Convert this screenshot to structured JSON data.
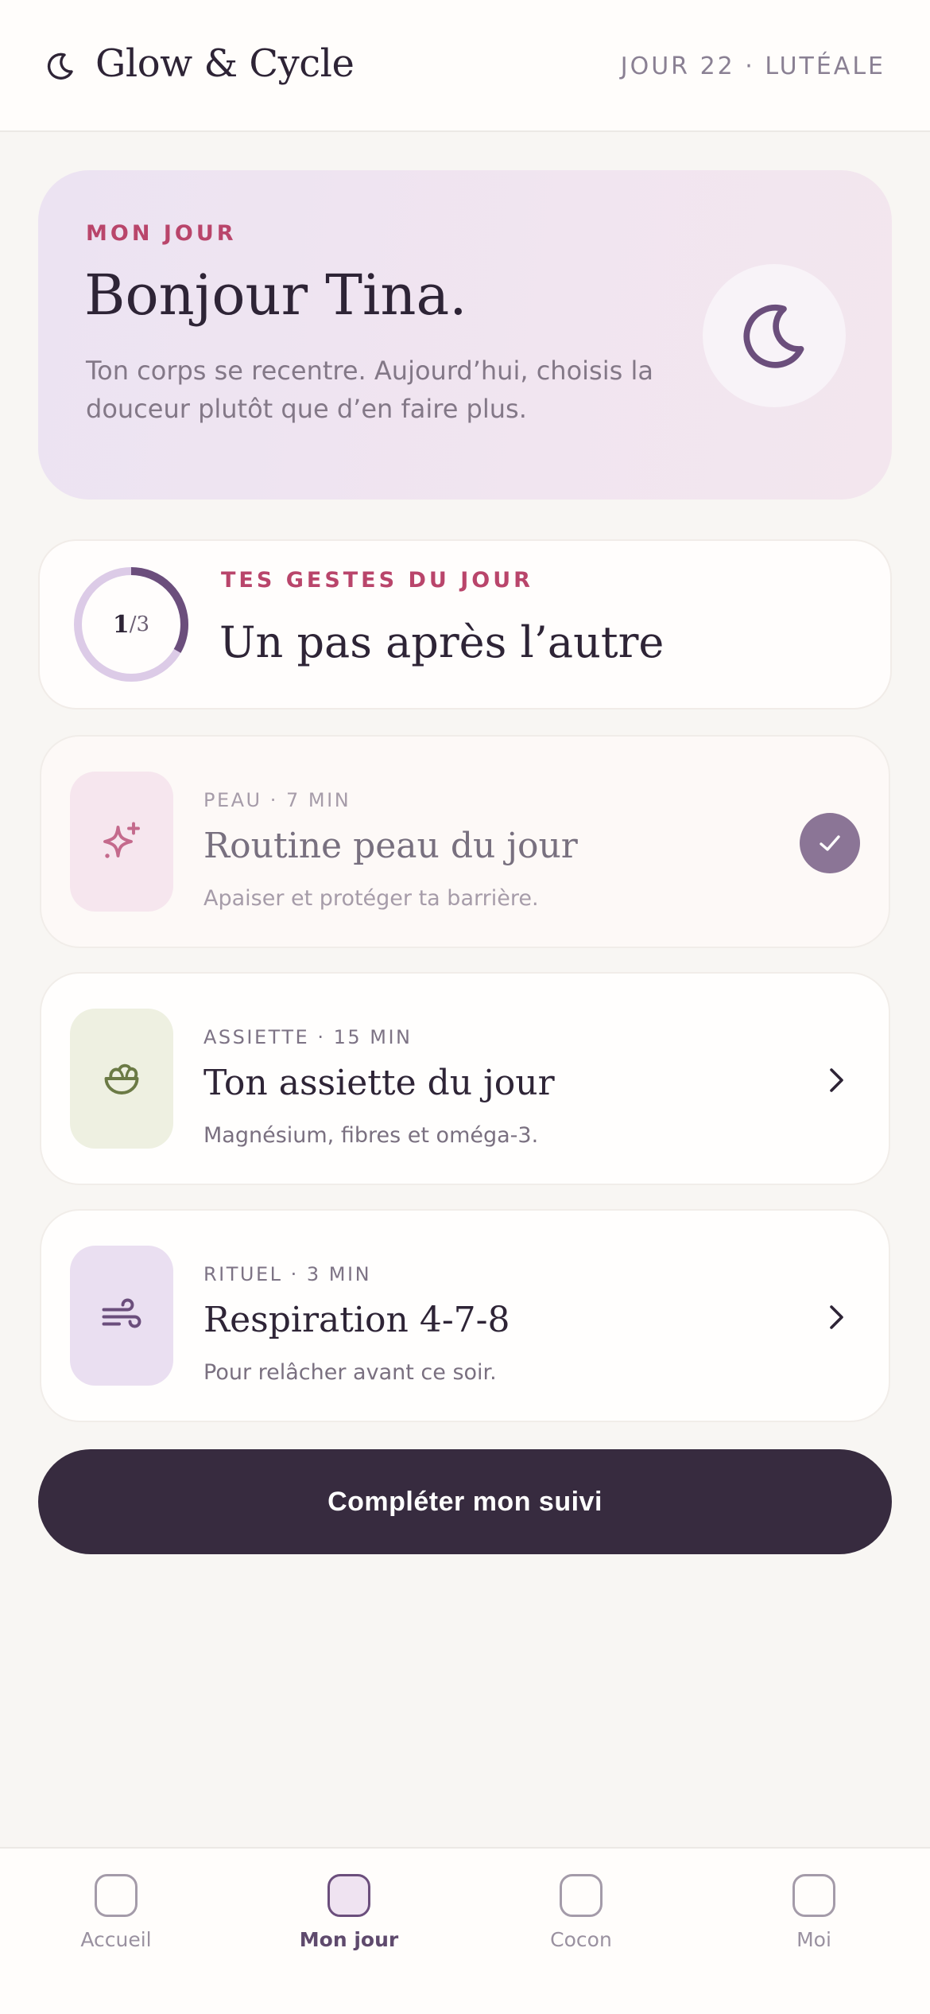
{
  "header": {
    "brand_icon": "crescent-moon-icon",
    "brand": "Glow & Cycle",
    "cycle_info": "JOUR 22 · LUTÉALE"
  },
  "hero": {
    "overline": "MON JOUR",
    "greeting": "Bonjour Tina.",
    "message": "Ton corps se recentre. Aujourd’hui, choisis la douceur plutôt que d’en faire plus.",
    "icon": "crescent-moon-icon"
  },
  "progress": {
    "completed": "1",
    "total": "/3",
    "completed_fraction": 0.333,
    "overline": "TES GESTES DU JOUR",
    "title": "Un pas après l’autre"
  },
  "tasks": [
    {
      "meta": "PEAU · 7 MIN",
      "title": "Routine peau du jour",
      "subtitle": "Apaiser et protéger ta barrière.",
      "icon": "sparkle-icon",
      "status": "done"
    },
    {
      "meta": "ASSIETTE · 15 MIN",
      "title": "Ton assiette du jour",
      "subtitle": "Magnésium, fibres et oméga-3.",
      "icon": "salad-bowl-icon",
      "status": "todo"
    },
    {
      "meta": "RITUEL · 3 MIN",
      "title": "Respiration 4-7-8",
      "subtitle": "Pour relâcher avant ce soir.",
      "icon": "wind-icon",
      "status": "todo"
    }
  ],
  "cta": {
    "label": "Compléter mon suivi"
  },
  "nav": {
    "items": [
      {
        "label": "Accueil",
        "active": false
      },
      {
        "label": "Mon jour",
        "active": true
      },
      {
        "label": "Cocon",
        "active": false
      },
      {
        "label": "Moi",
        "active": false
      }
    ]
  },
  "colors": {
    "accent_pink": "#b9456b",
    "plum": "#6b4e7c",
    "cta_dark": "#372b3f",
    "background": "#f8f6f3"
  }
}
